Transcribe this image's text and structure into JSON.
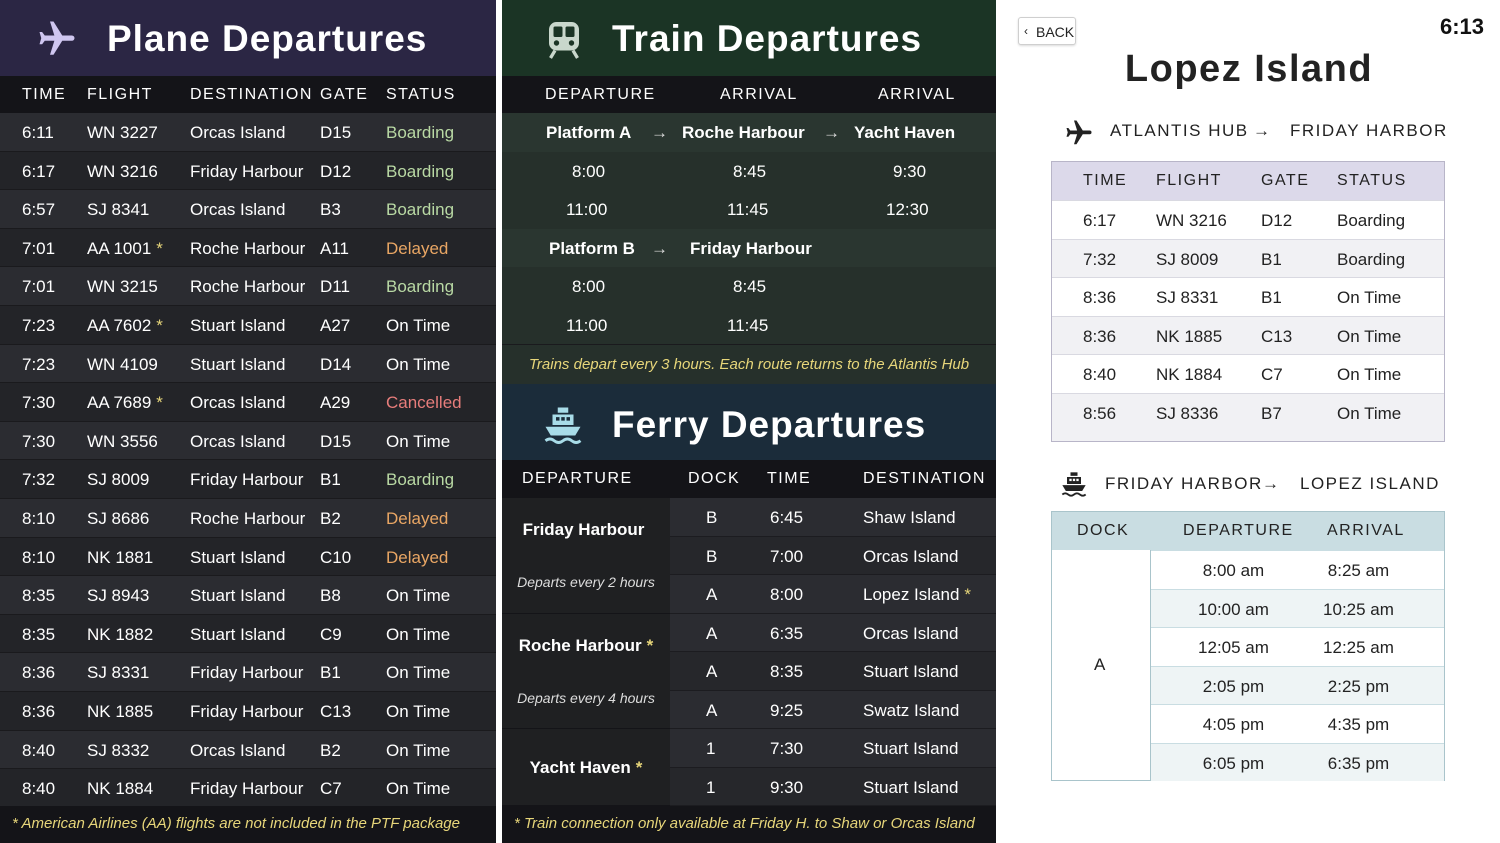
{
  "plane": {
    "title": "Plane Departures",
    "icon": "airplane-icon",
    "headers": {
      "time": "TIME",
      "flight": "FLIGHT",
      "destination": "DESTINATION",
      "gate": "GATE",
      "status": "STATUS"
    },
    "rows": [
      {
        "time": "6:11",
        "flight": "WN 3227",
        "star": "",
        "destination": "Orcas Island",
        "gate": "D15",
        "status": "Boarding",
        "status_color": "#b9d9a4"
      },
      {
        "time": "6:17",
        "flight": "WN 3216",
        "star": "",
        "destination": "Friday Harbour",
        "gate": "D12",
        "status": "Boarding",
        "status_color": "#b9d9a4"
      },
      {
        "time": "6:57",
        "flight": "SJ 8341",
        "star": "",
        "destination": "Orcas Island",
        "gate": "B3",
        "status": "Boarding",
        "status_color": "#b9d9a4"
      },
      {
        "time": "7:01",
        "flight": "AA 1001",
        "star": "*",
        "destination": "Roche Harbour",
        "gate": "A11",
        "status": "Delayed",
        "status_color": "#e9a664"
      },
      {
        "time": "7:01",
        "flight": "WN 3215",
        "star": "",
        "destination": "Roche Harbour",
        "gate": "D11",
        "status": "Boarding",
        "status_color": "#b9d9a4"
      },
      {
        "time": "7:23",
        "flight": "AA 7602",
        "star": "*",
        "destination": "Stuart Island",
        "gate": "A27",
        "status": "On Time",
        "status_color": "#ffffff"
      },
      {
        "time": "7:23",
        "flight": "WN 4109",
        "star": "",
        "destination": "Stuart Island",
        "gate": "D14",
        "status": "On Time",
        "status_color": "#ffffff"
      },
      {
        "time": "7:30",
        "flight": "AA 7689",
        "star": "*",
        "destination": "Orcas Island",
        "gate": "A29",
        "status": "Cancelled",
        "status_color": "#e77d7b"
      },
      {
        "time": "7:30",
        "flight": "WN 3556",
        "star": "",
        "destination": "Orcas Island",
        "gate": "D15",
        "status": "On Time",
        "status_color": "#ffffff"
      },
      {
        "time": "7:32",
        "flight": "SJ 8009",
        "star": "",
        "destination": "Friday Harbour",
        "gate": "B1",
        "status": "Boarding",
        "status_color": "#b9d9a4"
      },
      {
        "time": "8:10",
        "flight": "SJ  8686",
        "star": "",
        "destination": "Roche Harbour",
        "gate": "B2",
        "status": "Delayed",
        "status_color": "#e9a664"
      },
      {
        "time": "8:10",
        "flight": "NK 1881",
        "star": "",
        "destination": "Stuart Island",
        "gate": "C10",
        "status": "Delayed",
        "status_color": "#e9a664"
      },
      {
        "time": "8:35",
        "flight": "SJ 8943",
        "star": "",
        "destination": "Stuart Island",
        "gate": "B8",
        "status": "On Time",
        "status_color": "#ffffff"
      },
      {
        "time": "8:35",
        "flight": "NK 1882",
        "star": "",
        "destination": "Stuart Island",
        "gate": "C9",
        "status": "On Time",
        "status_color": "#ffffff"
      },
      {
        "time": "8:36",
        "flight": "SJ 8331",
        "star": "",
        "destination": "Friday Harbour",
        "gate": "B1",
        "status": "On Time",
        "status_color": "#ffffff"
      },
      {
        "time": "8:36",
        "flight": "NK 1885",
        "star": "",
        "destination": "Friday Harbour",
        "gate": "C13",
        "status": "On Time",
        "status_color": "#ffffff"
      },
      {
        "time": "8:40",
        "flight": "SJ 8332",
        "star": "",
        "destination": "Orcas Island",
        "gate": "B2",
        "status": "On Time",
        "status_color": "#ffffff"
      },
      {
        "time": "8:40",
        "flight": "NK 1884",
        "star": "",
        "destination": "Friday Harbour",
        "gate": "C7",
        "status": "On Time",
        "status_color": "#ffffff"
      }
    ],
    "footnote": "* American Airlines (AA) flights are not included in the PTF package"
  },
  "train": {
    "title": "Train Departures",
    "icon": "train-icon",
    "headers": {
      "departure": "DEPARTURE",
      "arrival1": "ARRIVAL",
      "arrival2": "ARRIVAL"
    },
    "route_a": {
      "from": "Platform A",
      "via": "Roche Harbour",
      "to": "Yacht Haven",
      "arrow": "→"
    },
    "route_a_times": [
      {
        "dep": "8:00",
        "arr1": "8:45",
        "arr2": "9:30"
      },
      {
        "dep": "11:00",
        "arr1": "11:45",
        "arr2": "12:30"
      }
    ],
    "route_b": {
      "from": "Platform B",
      "to": "Friday Harbour",
      "arrow": "→"
    },
    "route_b_times": [
      {
        "dep": "8:00",
        "arr1": "8:45"
      },
      {
        "dep": "11:00",
        "arr1": "11:45"
      }
    ],
    "note": "Trains depart every 3 hours. Each route returns to the Atlantis Hub"
  },
  "ferry": {
    "title": "Ferry Departures",
    "icon": "ship-icon",
    "headers": {
      "departure": "DEPARTURE",
      "dock": "DOCK",
      "time": "TIME",
      "destination": "DESTINATION"
    },
    "groups": [
      {
        "name": "Friday Harbour",
        "star": "",
        "sub": "Departs every 2 hours",
        "rows": [
          {
            "dock": "B",
            "time": "6:45",
            "destination": "Shaw Island",
            "star": ""
          },
          {
            "dock": "B",
            "time": "7:00",
            "destination": "Orcas Island",
            "star": ""
          },
          {
            "dock": "A",
            "time": "8:00",
            "destination": "Lopez Island",
            "star": "*"
          }
        ]
      },
      {
        "name": "Roche Harbour",
        "star": "*",
        "sub": "Departs every 4 hours",
        "rows": [
          {
            "dock": "A",
            "time": "6:35",
            "destination": "Orcas Island",
            "star": ""
          },
          {
            "dock": "A",
            "time": "8:35",
            "destination": "Stuart Island",
            "star": ""
          },
          {
            "dock": "A",
            "time": "9:25",
            "destination": "Swatz Island",
            "star": ""
          }
        ]
      },
      {
        "name": "Yacht Haven",
        "star": "*",
        "sub": "",
        "rows": [
          {
            "dock": "1",
            "time": "7:30",
            "destination": "Stuart Island",
            "star": ""
          },
          {
            "dock": "1",
            "time": "9:30",
            "destination": "Stuart Island",
            "star": ""
          }
        ]
      }
    ],
    "footnote": "* Train connection only available at Friday H. to Shaw or Orcas Island"
  },
  "detail": {
    "back_label": "BACK",
    "back_icon": "chevron-left-icon",
    "clock": "6:13",
    "title": "Lopez Island",
    "flight_route": {
      "from": "ATLANTIS HUB",
      "to": "FRIDAY HARBOR",
      "arrow": "→"
    },
    "flight_headers": {
      "time": "TIME",
      "flight": "FLIGHT",
      "gate": "GATE",
      "status": "STATUS"
    },
    "flights": [
      {
        "time": "6:17",
        "flight": "WN 3216",
        "gate": "D12",
        "status": "Boarding"
      },
      {
        "time": "7:32",
        "flight": "SJ 8009",
        "gate": "B1",
        "status": "Boarding"
      },
      {
        "time": "8:36",
        "flight": "SJ 8331",
        "gate": "B1",
        "status": "On Time"
      },
      {
        "time": "8:36",
        "flight": "NK 1885",
        "gate": "C13",
        "status": "On Time"
      },
      {
        "time": "8:40",
        "flight": "NK 1884",
        "gate": "C7",
        "status": "On Time"
      },
      {
        "time": "8:56",
        "flight": "SJ 8336",
        "gate": "B7",
        "status": "On Time"
      }
    ],
    "ferry_route": {
      "from": "FRIDAY HARBOR",
      "to": "LOPEZ ISLAND",
      "arrow": "→"
    },
    "ferry_headers": {
      "dock": "DOCK",
      "departure": "DEPARTURE",
      "arrival": "ARRIVAL"
    },
    "ferry_dock": "A",
    "ferries": [
      {
        "departure": "8:00 am",
        "arrival": "8:25 am"
      },
      {
        "departure": "10:00 am",
        "arrival": "10:25 am"
      },
      {
        "departure": "12:05 am",
        "arrival": "12:25 am"
      },
      {
        "departure": "2:05 pm",
        "arrival": "2:25 pm"
      },
      {
        "departure": "4:05 pm",
        "arrival": "4:35 pm"
      },
      {
        "departure": "6:05 pm",
        "arrival": "6:35 pm"
      }
    ],
    "colors": {
      "flight_header_bg": "#dcd9ea",
      "ferry_header_bg": "#c9dde2",
      "ferry_alt_row": "#eef4f5"
    }
  }
}
